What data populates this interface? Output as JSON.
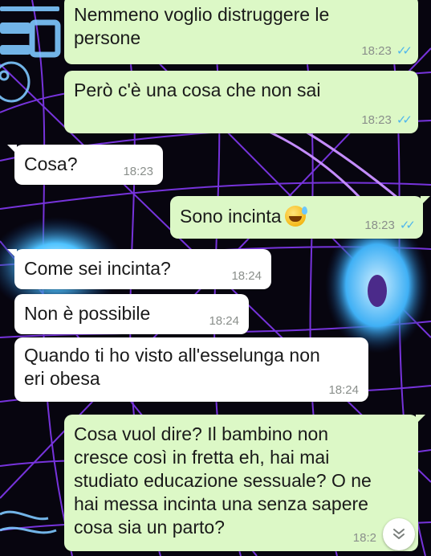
{
  "colors": {
    "outgoing_bubble": "#dcf8c6",
    "incoming_bubble": "#ffffff",
    "read_ticks": "#4fb6ec",
    "wallpaper_lines": "#8a3cff"
  },
  "messages": [
    {
      "direction": "outgoing",
      "text": "Nemmeno voglio distruggere le\npersone",
      "time": "18:23",
      "status": "read"
    },
    {
      "direction": "outgoing",
      "text": "Però c'è una cosa che non sai",
      "time": "18:23",
      "status": "read"
    },
    {
      "direction": "incoming",
      "text": "Cosa?",
      "time": "18:23"
    },
    {
      "direction": "outgoing",
      "text": "Sono incinta",
      "emoji": "sweat-smile-emoji",
      "time": "18:23",
      "status": "read"
    },
    {
      "direction": "incoming",
      "text": "Come sei incinta?",
      "time": "18:24"
    },
    {
      "direction": "incoming",
      "text": "Non è possibile",
      "time": "18:24"
    },
    {
      "direction": "incoming",
      "text": "Quando ti ho visto all'esselunga non\neri obesa",
      "time": "18:24"
    },
    {
      "direction": "outgoing",
      "text": "Cosa vuol dire? Il bambino non\ncresce così in fretta eh, hai mai\nstudiato educazione sessuale? O ne\nhai messa incinta una senza sapere\ncosa sia un parto?",
      "time": "18:2"
    }
  ],
  "icons": {
    "read_ticks": "double-check-icon",
    "scroll_down": "chevron-double-down-icon"
  }
}
